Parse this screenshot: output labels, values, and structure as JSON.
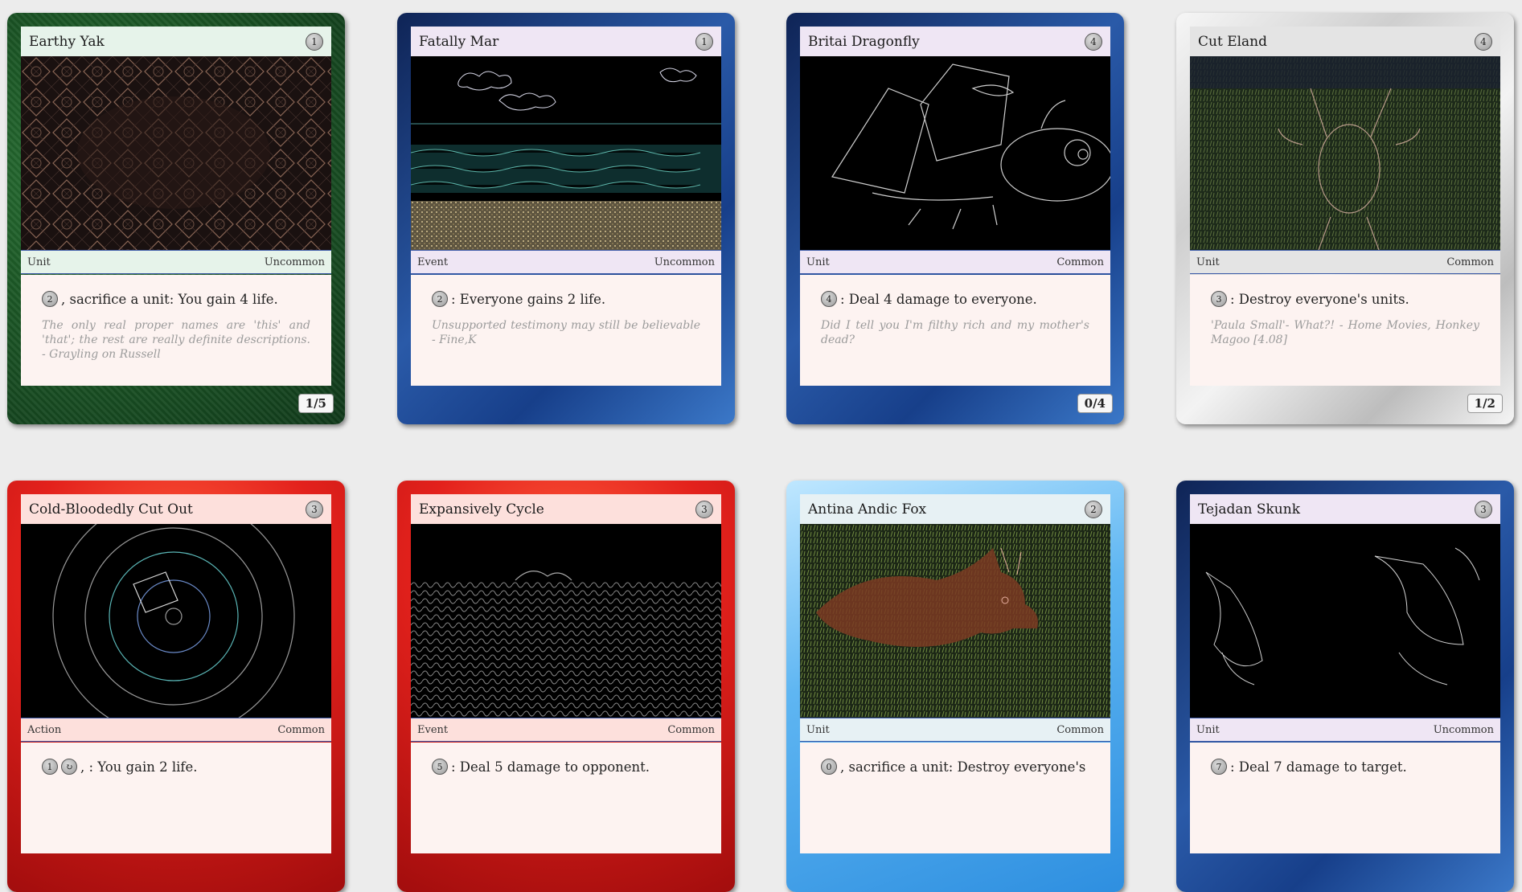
{
  "cards": [
    {
      "name": "Earthy Yak",
      "cost": "1",
      "type": "Unit",
      "rarity": "Uncommon",
      "cost_sym": "2",
      "rules": ", sacrifice a unit: You gain 4 life.",
      "flavor": "The only real proper names are 'this' and 'that'; the rest are really definite descriptions. - Grayling on Russell",
      "pt": "1/5",
      "frame": "green"
    },
    {
      "name": "Fatally Mar",
      "cost": "1",
      "type": "Event",
      "rarity": "Uncommon",
      "cost_sym": "2",
      "rules": ": Everyone gains 2 life.",
      "flavor": "Unsupported testimony may still be believable - Fine,K",
      "pt": "",
      "frame": "blue"
    },
    {
      "name": "Britai Dragonfly",
      "cost": "4",
      "type": "Unit",
      "rarity": "Common",
      "cost_sym": "4",
      "rules": ": Deal 4 damage to everyone.",
      "flavor": "Did I tell you I'm filthy rich and my mother's dead?",
      "pt": "0/4",
      "frame": "blue"
    },
    {
      "name": "Cut Eland",
      "cost": "4",
      "type": "Unit",
      "rarity": "Common",
      "cost_sym": "3",
      "rules": ": Destroy everyone's units.",
      "flavor": "'Paula Small'- What?! - Home Movies, Honkey Magoo [4.08]",
      "pt": "1/2",
      "frame": "white"
    },
    {
      "name": "Cold-Bloodedly Cut Out",
      "cost": "3",
      "type": "Action",
      "rarity": "Common",
      "cost_sym": "1",
      "rules": ", : You gain 2 life.",
      "frame": "red"
    },
    {
      "name": "Expansively Cycle",
      "cost": "3",
      "type": "Event",
      "rarity": "Common",
      "cost_sym": "5",
      "rules": ": Deal 5 damage to opponent.",
      "frame": "red"
    },
    {
      "name": "Antina Andic Fox",
      "cost": "2",
      "type": "Unit",
      "rarity": "Common",
      "cost_sym": "0",
      "rules": ", sacrifice a unit: Destroy everyone's",
      "frame": "lightblue"
    },
    {
      "name": "Tejadan Skunk",
      "cost": "3",
      "type": "Unit",
      "rarity": "Uncommon",
      "cost_sym": "7",
      "rules": ": Deal 7 damage to target.",
      "frame": "blue"
    }
  ]
}
